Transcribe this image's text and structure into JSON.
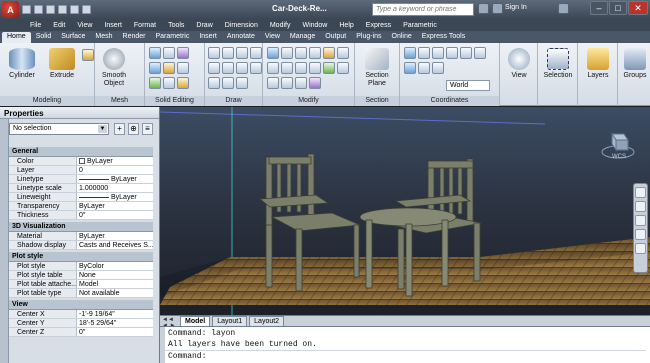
{
  "window": {
    "app_button_label": "A",
    "title": "Car-Deck-Re...",
    "search_placeholder": "Type a keyword or phrase",
    "sign_in_label": "Sign In",
    "controls": {
      "minimize": "–",
      "maximize": "□",
      "close": "✕"
    }
  },
  "menu": [
    "File",
    "Edit",
    "View",
    "Insert",
    "Format",
    "Tools",
    "Draw",
    "Dimension",
    "Modify",
    "Window",
    "Help",
    "Express",
    "Parametric"
  ],
  "ribbon_tabs": [
    "Home",
    "Solid",
    "Surface",
    "Mesh",
    "Render",
    "Parametric",
    "Insert",
    "Annotate",
    "View",
    "Manage",
    "Output",
    "Plug-ins",
    "Online",
    "Express Tools"
  ],
  "active_tab": "Home",
  "ribbon": {
    "tools": {
      "cylinder": "Cylinder",
      "extrude": "Extrude",
      "smooth_object": "Smooth Object",
      "section_plane": "Section Plane",
      "view": "View",
      "selection": "Selection",
      "layers": "Layers",
      "groups": "Groups"
    },
    "panels": {
      "modeling": "Modeling",
      "mesh": "Mesh",
      "solid_editing": "Solid Editing",
      "draw": "Draw",
      "modify": "Modify",
      "section": "Section",
      "coordinates": "Coordinates"
    },
    "coordinates_dropdown": "World"
  },
  "properties": {
    "title": "Properties",
    "selection": "No selection",
    "sections": {
      "general": "General",
      "viz": "3D Visualization",
      "plot": "Plot style",
      "view": "View"
    },
    "general": [
      {
        "k": "Color",
        "v": "ByLayer"
      },
      {
        "k": "Layer",
        "v": "0"
      },
      {
        "k": "Linetype",
        "v": "ByLayer"
      },
      {
        "k": "Linetype scale",
        "v": "1.000000"
      },
      {
        "k": "Lineweight",
        "v": "ByLayer"
      },
      {
        "k": "Transparency",
        "v": "ByLayer"
      },
      {
        "k": "Thickness",
        "v": "0\""
      }
    ],
    "viz": [
      {
        "k": "Material",
        "v": "ByLayer"
      },
      {
        "k": "Shadow display",
        "v": "Casts and Receives S..."
      }
    ],
    "plot": [
      {
        "k": "Plot style",
        "v": "ByColor"
      },
      {
        "k": "Plot style table",
        "v": "None"
      },
      {
        "k": "Plot table attache...",
        "v": "Model"
      },
      {
        "k": "Plot table type",
        "v": "Not available"
      }
    ],
    "view": [
      {
        "k": "Center X",
        "v": "-1'-9 19/64\""
      },
      {
        "k": "Center Y",
        "v": "18'-5 29/64\""
      },
      {
        "k": "Center Z",
        "v": "0\""
      }
    ]
  },
  "viewport": {
    "viewcube_label": "WCS"
  },
  "layout_tabs": [
    "Model",
    "Layout1",
    "Layout2"
  ],
  "layout_arrows": "◄◄ ◄ ► ►►",
  "command": {
    "lines": [
      "Command: layon",
      "All layers have been turned on."
    ],
    "prompt": "Command:"
  },
  "colors": {
    "titlebar": "#3c4756",
    "close": "#b8342c",
    "floor": "#8a6a3a",
    "furniture": "#7b7f6a"
  }
}
